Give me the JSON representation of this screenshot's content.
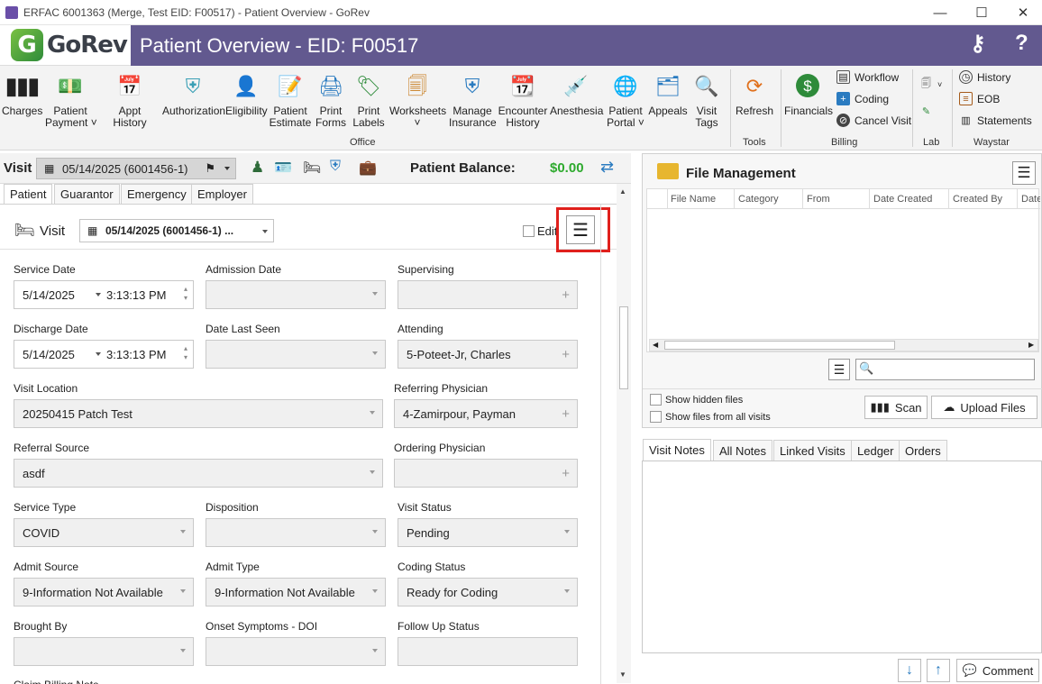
{
  "window": {
    "title": "ERFAC 6001363 (Merge, Test EID: F00517) - Patient Overview - GoRev",
    "app_icon": "GoRev"
  },
  "header": {
    "logo_text": "GoRev",
    "title": "Patient Overview - EID: F00517"
  },
  "ribbon": {
    "office": [
      {
        "label": "Charges",
        "icon": "barcode-icon"
      },
      {
        "label": "Patient\nPayment ˅",
        "icon": "payment-icon"
      },
      {
        "label": "Appt History",
        "icon": "calendar-icon"
      },
      {
        "label": "Authorization",
        "icon": "shield-icon"
      },
      {
        "label": "Eligibility",
        "icon": "user-check-icon"
      },
      {
        "label": "Patient\nEstimate",
        "icon": "estimate-icon"
      },
      {
        "label": "Print\nForms",
        "icon": "printer-icon"
      },
      {
        "label": "Print\nLabels",
        "icon": "label-icon"
      },
      {
        "label": "Worksheets\n˅",
        "icon": "worksheet-icon"
      },
      {
        "label": "Manage\nInsurance",
        "icon": "insurance-icon"
      },
      {
        "label": "Encounter\nHistory",
        "icon": "encounter-icon"
      },
      {
        "label": "Anesthesia",
        "icon": "syringe-icon"
      },
      {
        "label": "Patient\nPortal ˅",
        "icon": "globe-icon"
      },
      {
        "label": "Appeals",
        "icon": "appeals-icon"
      },
      {
        "label": "Visit\nTags",
        "icon": "tags-icon"
      }
    ],
    "office_group": "Office",
    "tools": {
      "refresh": "Refresh",
      "group": "Tools"
    },
    "billing": {
      "financials": "Financials",
      "workflow": "Workflow",
      "coding": "Coding",
      "cancel_visit": "Cancel Visit",
      "group": "Billing"
    },
    "lab": {
      "group": "Lab"
    },
    "waystar": {
      "history": "History",
      "eob": "EOB",
      "statements": "Statements",
      "group": "Waystar"
    }
  },
  "visitbar": {
    "label": "Visit",
    "visit_value": "05/14/2025 (6001456-1)",
    "balance_label": "Patient Balance:",
    "balance_value": "$0.00"
  },
  "tabs": [
    "Patient",
    "Guarantor",
    "Emergency",
    "Employer"
  ],
  "visit_panel": {
    "title": "Visit",
    "visit_select": "05/14/2025 (6001456-1) ...",
    "edit_label": "Edit"
  },
  "form": {
    "service_date": {
      "label": "Service Date",
      "date": "5/14/2025",
      "time": "3:13:13 PM"
    },
    "admission_date": {
      "label": "Admission Date",
      "value": ""
    },
    "supervising": {
      "label": "Supervising",
      "value": ""
    },
    "discharge_date": {
      "label": "Discharge Date",
      "date": "5/14/2025",
      "time": "3:13:13 PM"
    },
    "date_last_seen": {
      "label": "Date Last Seen",
      "value": ""
    },
    "attending": {
      "label": "Attending",
      "value": "5-Poteet-Jr, Charles"
    },
    "visit_location": {
      "label": "Visit Location",
      "value": "20250415 Patch Test"
    },
    "referring_physician": {
      "label": "Referring Physician",
      "value": "4-Zamirpour, Payman"
    },
    "referral_source": {
      "label": "Referral Source",
      "value": "asdf"
    },
    "ordering_physician": {
      "label": "Ordering Physician",
      "value": ""
    },
    "service_type": {
      "label": "Service Type",
      "value": "COVID"
    },
    "disposition": {
      "label": "Disposition",
      "value": ""
    },
    "visit_status": {
      "label": "Visit Status",
      "value": "Pending"
    },
    "admit_source": {
      "label": "Admit Source",
      "value": "9-Information Not Available"
    },
    "admit_type": {
      "label": "Admit Type",
      "value": "9-Information Not Available"
    },
    "coding_status": {
      "label": "Coding Status",
      "value": "Ready for Coding"
    },
    "brought_by": {
      "label": "Brought By",
      "value": ""
    },
    "onset_symptoms": {
      "label": "Onset Symptoms - DOI",
      "value": ""
    },
    "follow_up_status": {
      "label": "Follow Up Status",
      "value": ""
    },
    "claim_billing_note": {
      "label": "Claim Billing Note"
    }
  },
  "file_mgmt": {
    "title": "File Management",
    "columns": [
      "File Name",
      "Category",
      "From",
      "Date Created",
      "Created By",
      "Date"
    ],
    "show_hidden": "Show hidden files",
    "show_all_visits": "Show files from all visits",
    "scan": "Scan",
    "upload": "Upload Files"
  },
  "notes": {
    "tabs": [
      "Visit Notes",
      "All Notes",
      "Linked Visits",
      "Ledger",
      "Orders"
    ],
    "comment": "Comment"
  },
  "colors": {
    "header": "#62598f",
    "balance": "#2eaa2e",
    "highlight": "#e0201c"
  }
}
